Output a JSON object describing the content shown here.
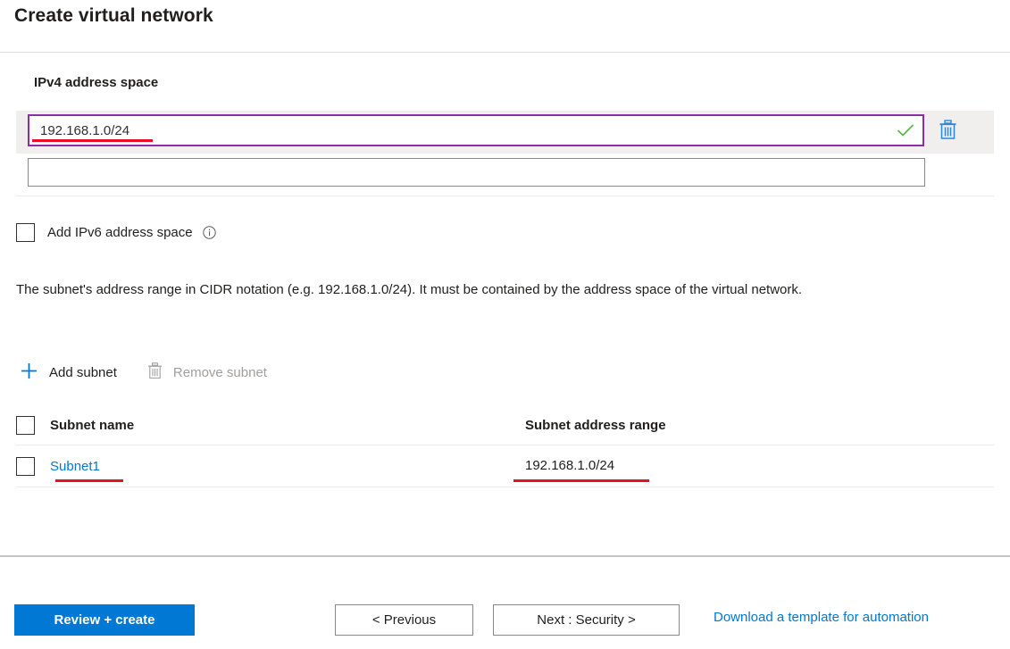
{
  "page": {
    "title": "Create virtual network"
  },
  "address_space": {
    "label": "IPv4 address space",
    "entries": [
      {
        "value": "192.168.1.0/24",
        "placeholder": "",
        "valid_icon": "check-icon",
        "delete_icon": "trash-icon"
      },
      {
        "value": "",
        "placeholder": ""
      }
    ]
  },
  "ipv6": {
    "checkbox_label": "Add IPv6 address space",
    "checked": false,
    "info_icon": "info-icon"
  },
  "description": "The subnet's address range in CIDR notation (e.g. 192.168.1.0/24). It must be contained by the address space of the virtual network.",
  "commands": {
    "add_subnet": "Add subnet",
    "add_icon": "plus-icon",
    "remove_subnet": "Remove subnet",
    "remove_icon": "trash-icon",
    "remove_disabled": true
  },
  "subnet_table": {
    "columns": [
      "Subnet name",
      "Subnet address range"
    ],
    "rows": [
      {
        "name": "Subnet1",
        "range": "192.168.1.0/24",
        "selected": false
      }
    ]
  },
  "footer": {
    "review_create": "Review + create",
    "previous": "< Previous",
    "next": "Next : Security >",
    "download_template": "Download a template for automation"
  },
  "colors": {
    "accent": "#0078d4",
    "focus_border": "#8e2da8",
    "valid_check": "#5ab946",
    "annotation": "#e81123",
    "row_background": "#f0efee",
    "disabled_text": "#a19f9d"
  }
}
